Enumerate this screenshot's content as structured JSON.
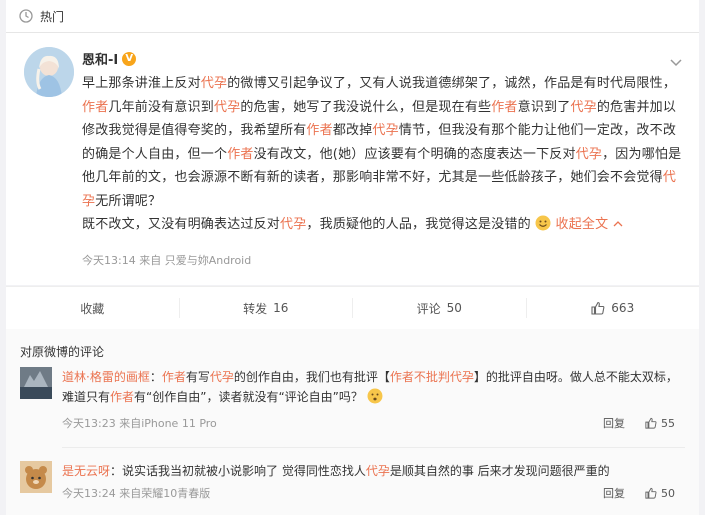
{
  "topbar": {
    "icon": "hot-icon",
    "label": "热门"
  },
  "post": {
    "author": "恩和-I",
    "badge": "V",
    "paragraph1": [
      {
        "t": "早上那条讲淮上反对"
      },
      {
        "t": "代孕",
        "h": 1
      },
      {
        "t": "的微博又引起争议了，又有人说我道德绑架了，诚然，作品是有时代局限性，"
      },
      {
        "t": "作者",
        "h": 1
      },
      {
        "t": "几年前没有意识到"
      },
      {
        "t": "代孕",
        "h": 1
      },
      {
        "t": "的危害，她写了我没说什么，但是现在有些"
      },
      {
        "t": "作者",
        "h": 1
      },
      {
        "t": "意识到了"
      },
      {
        "t": "代孕",
        "h": 1
      },
      {
        "t": "的危害并加以修改我觉得是值得夸奖的，我希望所有"
      },
      {
        "t": "作者",
        "h": 1
      },
      {
        "t": "都改掉"
      },
      {
        "t": "代孕",
        "h": 1
      },
      {
        "t": "情节，但我没有那个能力让他们一定改，改不改的确是个人自由，但一个"
      },
      {
        "t": "作者",
        "h": 1
      },
      {
        "t": "没有改文，他(她）应该要有个明确的态度表达一下反对"
      },
      {
        "t": "代孕",
        "h": 1
      },
      {
        "t": "，因为哪怕是他几年前的文，也会源源不断有新的读者，那影响非常不好，尤其是一些低龄孩子，她们会不会觉得"
      },
      {
        "t": "代孕",
        "h": 1
      },
      {
        "t": "无所谓呢？"
      }
    ],
    "paragraph2": [
      {
        "t": "既不改文，又没有明确表达过反对"
      },
      {
        "t": "代孕",
        "h": 1
      },
      {
        "t": "，我质疑他的人品，我觉得这是没错的"
      }
    ],
    "collapse_label": "收起全文",
    "meta": "今天13:14  来自 只爱与妳Android"
  },
  "actions": {
    "favorite": "收藏",
    "repost_label": "转发",
    "repost_count": "16",
    "comment_label": "评论",
    "comment_count": "50",
    "like_count": "663"
  },
  "comments_header": "对原微博的评论",
  "comments": [
    {
      "name": "道林·格雷的画框",
      "parts": [
        {
          "t": "："
        },
        {
          "t": "作者",
          "h": 1
        },
        {
          "t": "有写"
        },
        {
          "t": "代孕",
          "h": 1
        },
        {
          "t": "的创作自由，我们也有批评【"
        },
        {
          "t": "作者不批判代孕",
          "h": 1
        },
        {
          "t": "】的批评自由呀。做人总不能太双标，难道只有"
        },
        {
          "t": "作者",
          "h": 1
        },
        {
          "t": "有“创作自由”，读者就没有“评论自由”吗？"
        }
      ],
      "meta": "今天13:23  来自iPhone 11 Pro",
      "reply": "回复",
      "likes": "55"
    },
    {
      "name": "是无云呀",
      "parts": [
        {
          "t": "：说实话我当初就被小说影响了 觉得同性恋找人"
        },
        {
          "t": "代孕",
          "h": 1
        },
        {
          "t": "是顺其自然的事 后来才发现问题很严重的"
        }
      ],
      "meta": "今天13:24  来自荣耀10青春版",
      "reply": "回复",
      "likes": "50"
    }
  ],
  "colors": {
    "accent": "#eb7350",
    "meta": "#999999",
    "highlight_link": "#eb7350"
  }
}
